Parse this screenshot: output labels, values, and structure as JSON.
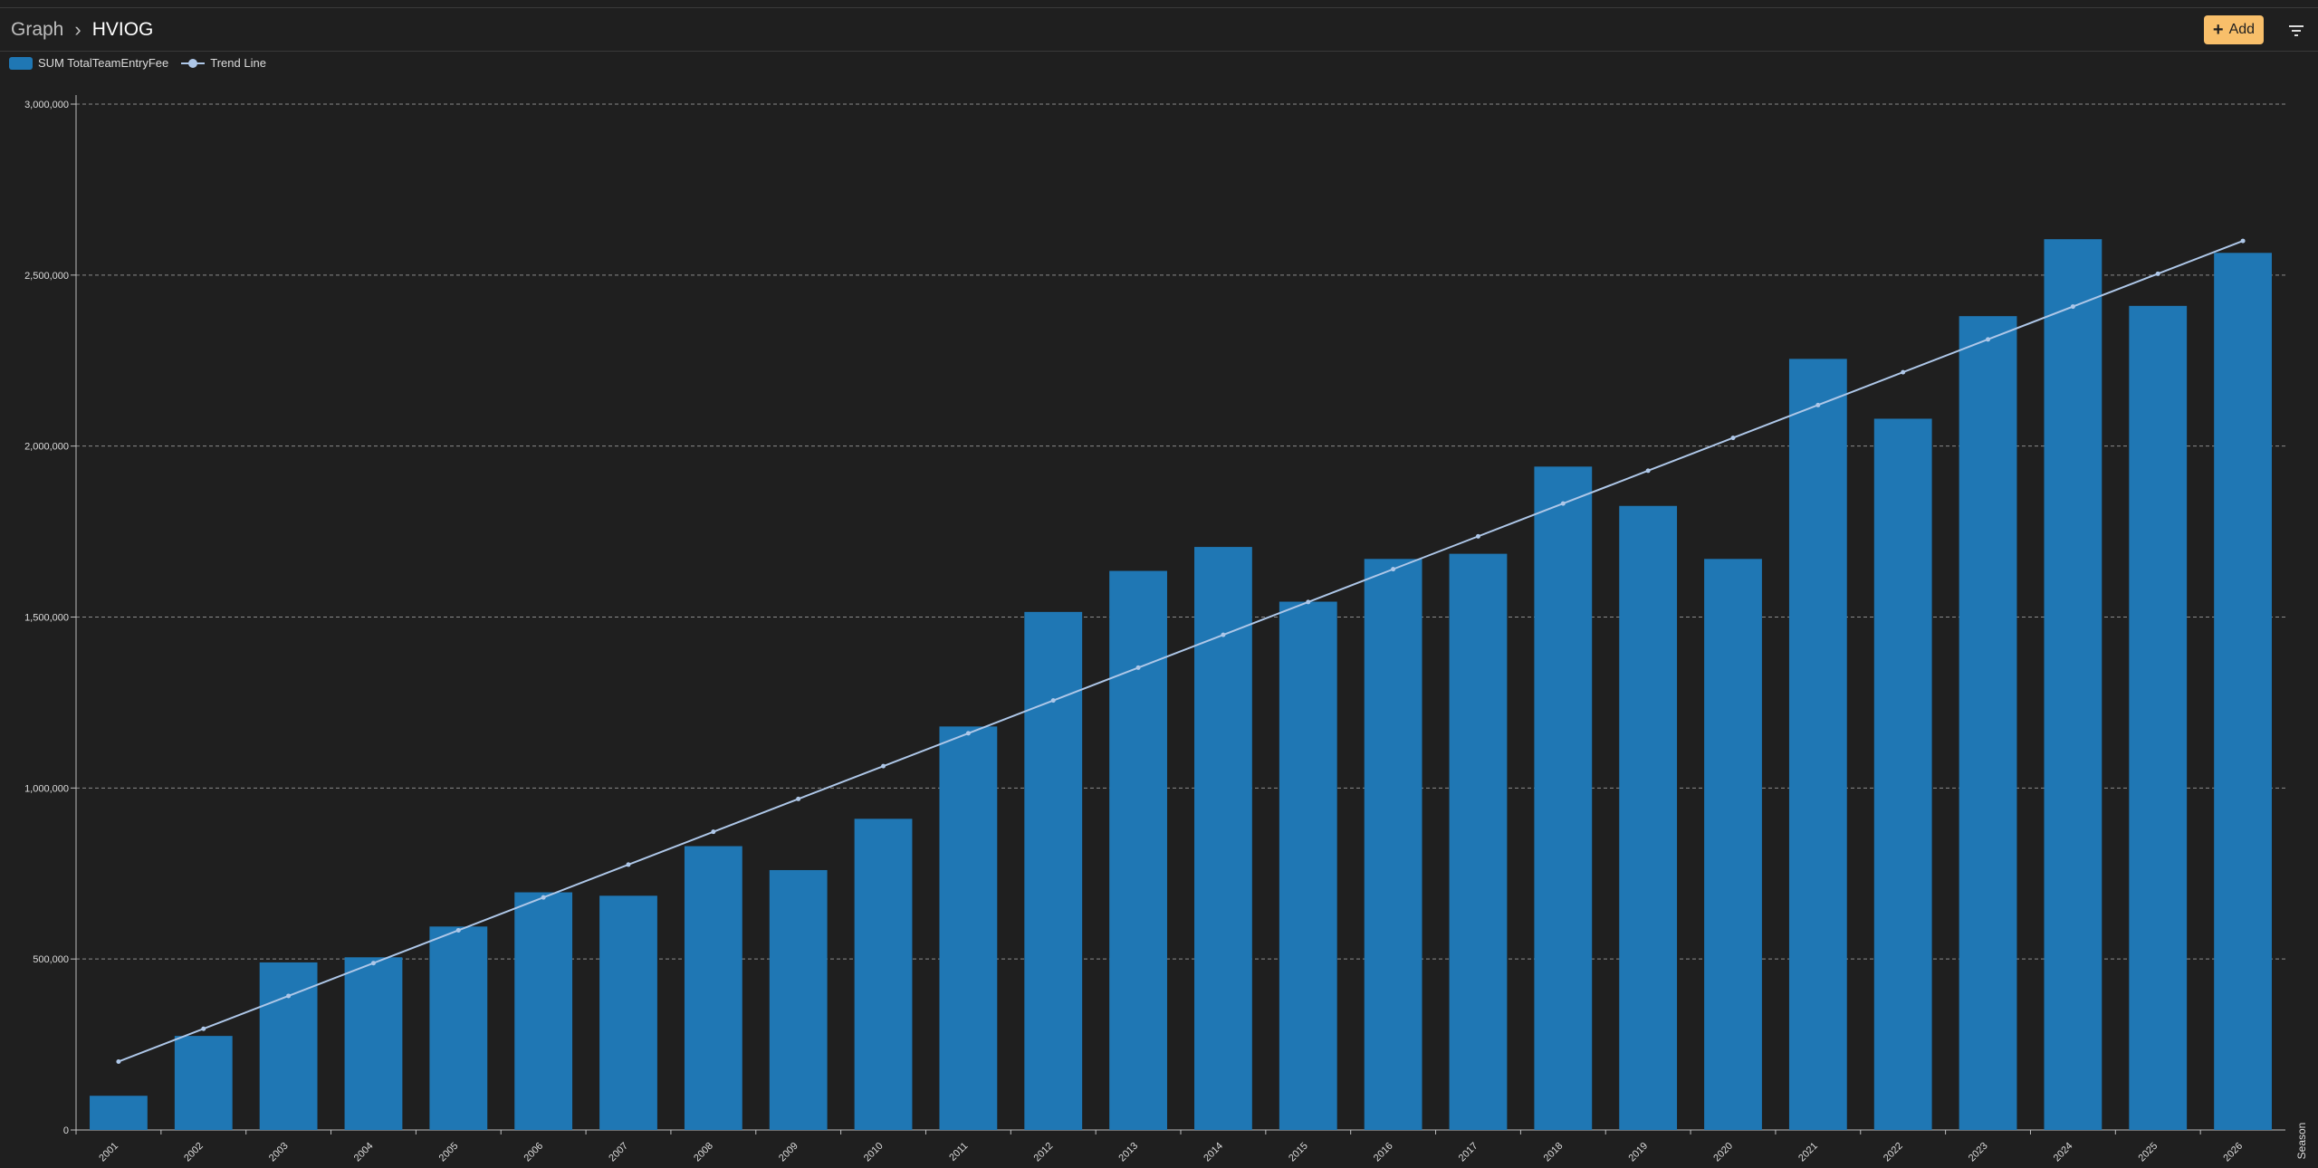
{
  "header": {
    "breadcrumb_root": "Graph",
    "breadcrumb_current": "HVIOG",
    "add_label": "Add"
  },
  "colors": {
    "background": "#1f1f1f",
    "bar": "#1f77b4",
    "trend": "#aec7e8",
    "accent": "#f8bf6a"
  },
  "chart_data": {
    "type": "bar",
    "categories": [
      "2001",
      "2002",
      "2003",
      "2004",
      "2005",
      "2006",
      "2007",
      "2008",
      "2009",
      "2010",
      "2011",
      "2012",
      "2013",
      "2014",
      "2015",
      "2016",
      "2017",
      "2018",
      "2019",
      "2020",
      "2021",
      "2022",
      "2023",
      "2024",
      "2025",
      "2026"
    ],
    "series": [
      {
        "name": "SUM TotalTeamEntryFee",
        "type": "bar",
        "values": [
          100000,
          275000,
          490000,
          505000,
          595000,
          695000,
          685000,
          830000,
          760000,
          910000,
          1180000,
          1515000,
          1635000,
          1705000,
          1545000,
          1670000,
          1685000,
          1940000,
          1825000,
          1670000,
          2255000,
          2080000,
          2380000,
          2605000,
          2410000,
          2565000
        ]
      },
      {
        "name": "Trend Line",
        "type": "line",
        "values": [
          200000,
          296000,
          392000,
          488000,
          584000,
          680000,
          776000,
          872000,
          968000,
          1064000,
          1160000,
          1256000,
          1352000,
          1448000,
          1544000,
          1640000,
          1736000,
          1832000,
          1928000,
          2024000,
          2120000,
          2216000,
          2312000,
          2408000,
          2504000,
          2600000
        ]
      }
    ],
    "ylim": [
      0,
      3000000
    ],
    "yticks": [
      "0",
      "500,000",
      "1,000,000",
      "1,500,000",
      "2,000,000",
      "2,500,000",
      "3,000,000"
    ],
    "xlabel": "Season",
    "ylabel": "",
    "grid": true,
    "legend_position": "top-left"
  }
}
